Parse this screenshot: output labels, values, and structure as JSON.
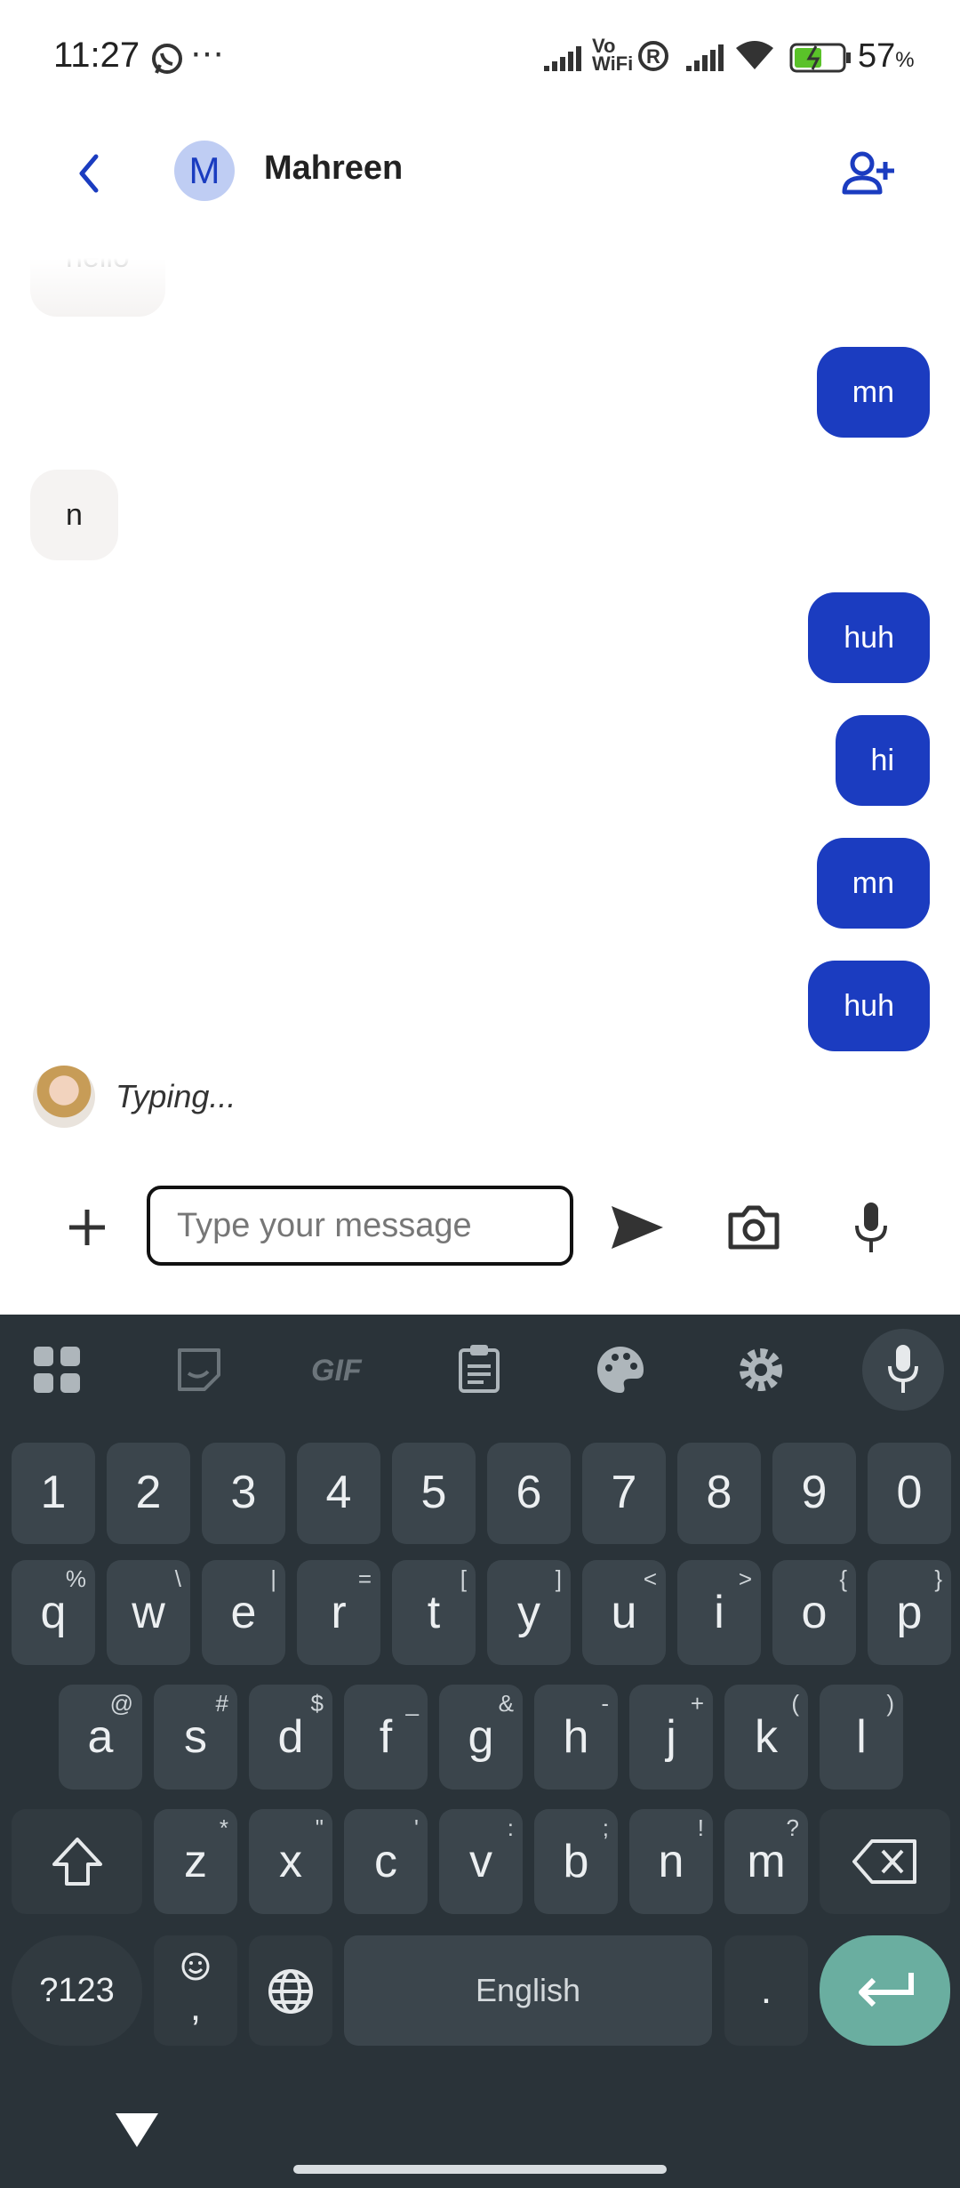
{
  "status_bar": {
    "time": "11:27",
    "battery": "57",
    "battery_unit": "%",
    "vowifi_line1": "Vo",
    "vowifi_line2": "WiFi",
    "registered": "R"
  },
  "header": {
    "avatar_initial": "M",
    "contact_name": "Mahreen"
  },
  "messages": [
    {
      "dir": "in",
      "text": "hello"
    },
    {
      "dir": "out",
      "text": "mn"
    },
    {
      "dir": "in",
      "text": "n"
    },
    {
      "dir": "out",
      "text": "huh"
    },
    {
      "dir": "out",
      "text": "hi"
    },
    {
      "dir": "out",
      "text": "mn"
    },
    {
      "dir": "out",
      "text": "huh"
    }
  ],
  "typing_indicator": "Typing...",
  "composer": {
    "placeholder": "Type your message"
  },
  "keyboard": {
    "toolbar_gif": "GIF",
    "number_row": [
      "1",
      "2",
      "3",
      "4",
      "5",
      "6",
      "7",
      "8",
      "9",
      "0"
    ],
    "row1": [
      {
        "k": "q",
        "a": "%"
      },
      {
        "k": "w",
        "a": "\\"
      },
      {
        "k": "e",
        "a": "|"
      },
      {
        "k": "r",
        "a": "="
      },
      {
        "k": "t",
        "a": "["
      },
      {
        "k": "y",
        "a": "]"
      },
      {
        "k": "u",
        "a": "<"
      },
      {
        "k": "i",
        "a": ">"
      },
      {
        "k": "o",
        "a": "{"
      },
      {
        "k": "p",
        "a": "}"
      }
    ],
    "row2": [
      {
        "k": "a",
        "a": "@"
      },
      {
        "k": "s",
        "a": "#"
      },
      {
        "k": "d",
        "a": "$"
      },
      {
        "k": "f",
        "a": "_"
      },
      {
        "k": "g",
        "a": "&"
      },
      {
        "k": "h",
        "a": "-"
      },
      {
        "k": "j",
        "a": "+"
      },
      {
        "k": "k",
        "a": "("
      },
      {
        "k": "l",
        "a": ")"
      }
    ],
    "row3": [
      {
        "k": "z",
        "a": "*"
      },
      {
        "k": "x",
        "a": "\""
      },
      {
        "k": "c",
        "a": "'"
      },
      {
        "k": "v",
        "a": ":"
      },
      {
        "k": "b",
        "a": ";"
      },
      {
        "k": "n",
        "a": "!"
      },
      {
        "k": "m",
        "a": "?"
      }
    ],
    "symbols_label": "?123",
    "comma_label": ",",
    "space_label": "English",
    "period_label": "."
  },
  "colors": {
    "accent": "#1b3cc0",
    "keyboard_bg": "#2a3339",
    "key_bg": "#3b454c",
    "enter_key": "#6aaea0"
  }
}
